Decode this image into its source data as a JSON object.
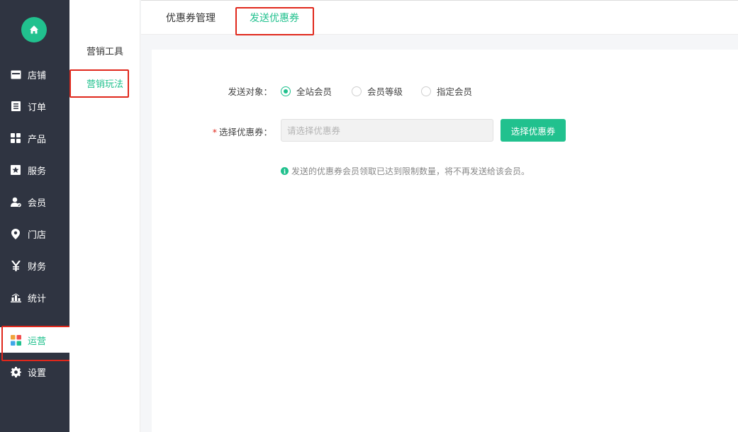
{
  "sidebar": {
    "items": [
      {
        "label": "店铺",
        "icon": "store-icon"
      },
      {
        "label": "订单",
        "icon": "order-list-icon"
      },
      {
        "label": "产品",
        "icon": "grid-icon"
      },
      {
        "label": "服务",
        "icon": "service-icon"
      },
      {
        "label": "会员",
        "icon": "member-icon"
      },
      {
        "label": "门店",
        "icon": "location-pin-icon"
      },
      {
        "label": "财务",
        "icon": "yen-icon"
      },
      {
        "label": "统计",
        "icon": "bar-chart-icon"
      },
      {
        "label": "运营",
        "icon": "apps-icon"
      },
      {
        "label": "设置",
        "icon": "gear-icon"
      }
    ],
    "active": "运营"
  },
  "submenu": {
    "items": [
      {
        "label": "营销工具"
      },
      {
        "label": "营销玩法"
      }
    ],
    "active": "营销玩法"
  },
  "tabs": {
    "items": [
      {
        "label": "优惠券管理"
      },
      {
        "label": "发送优惠券"
      }
    ],
    "active": "发送优惠券"
  },
  "form": {
    "target_label": "发送对象：",
    "target_options": [
      "全站会员",
      "会员等级",
      "指定会员"
    ],
    "target_selected": "全站会员",
    "coupon_required": "*",
    "coupon_label": "选择优惠券：",
    "coupon_placeholder": "请选择优惠券",
    "coupon_value": "",
    "select_button": "选择优惠券",
    "tip": "发送的优惠券会员领取已达到限制数量，将不再发送给该会员。"
  },
  "colors": {
    "accent": "#21c18e",
    "sidebar_bg": "#2f3441",
    "highlight": "#e0281c"
  }
}
